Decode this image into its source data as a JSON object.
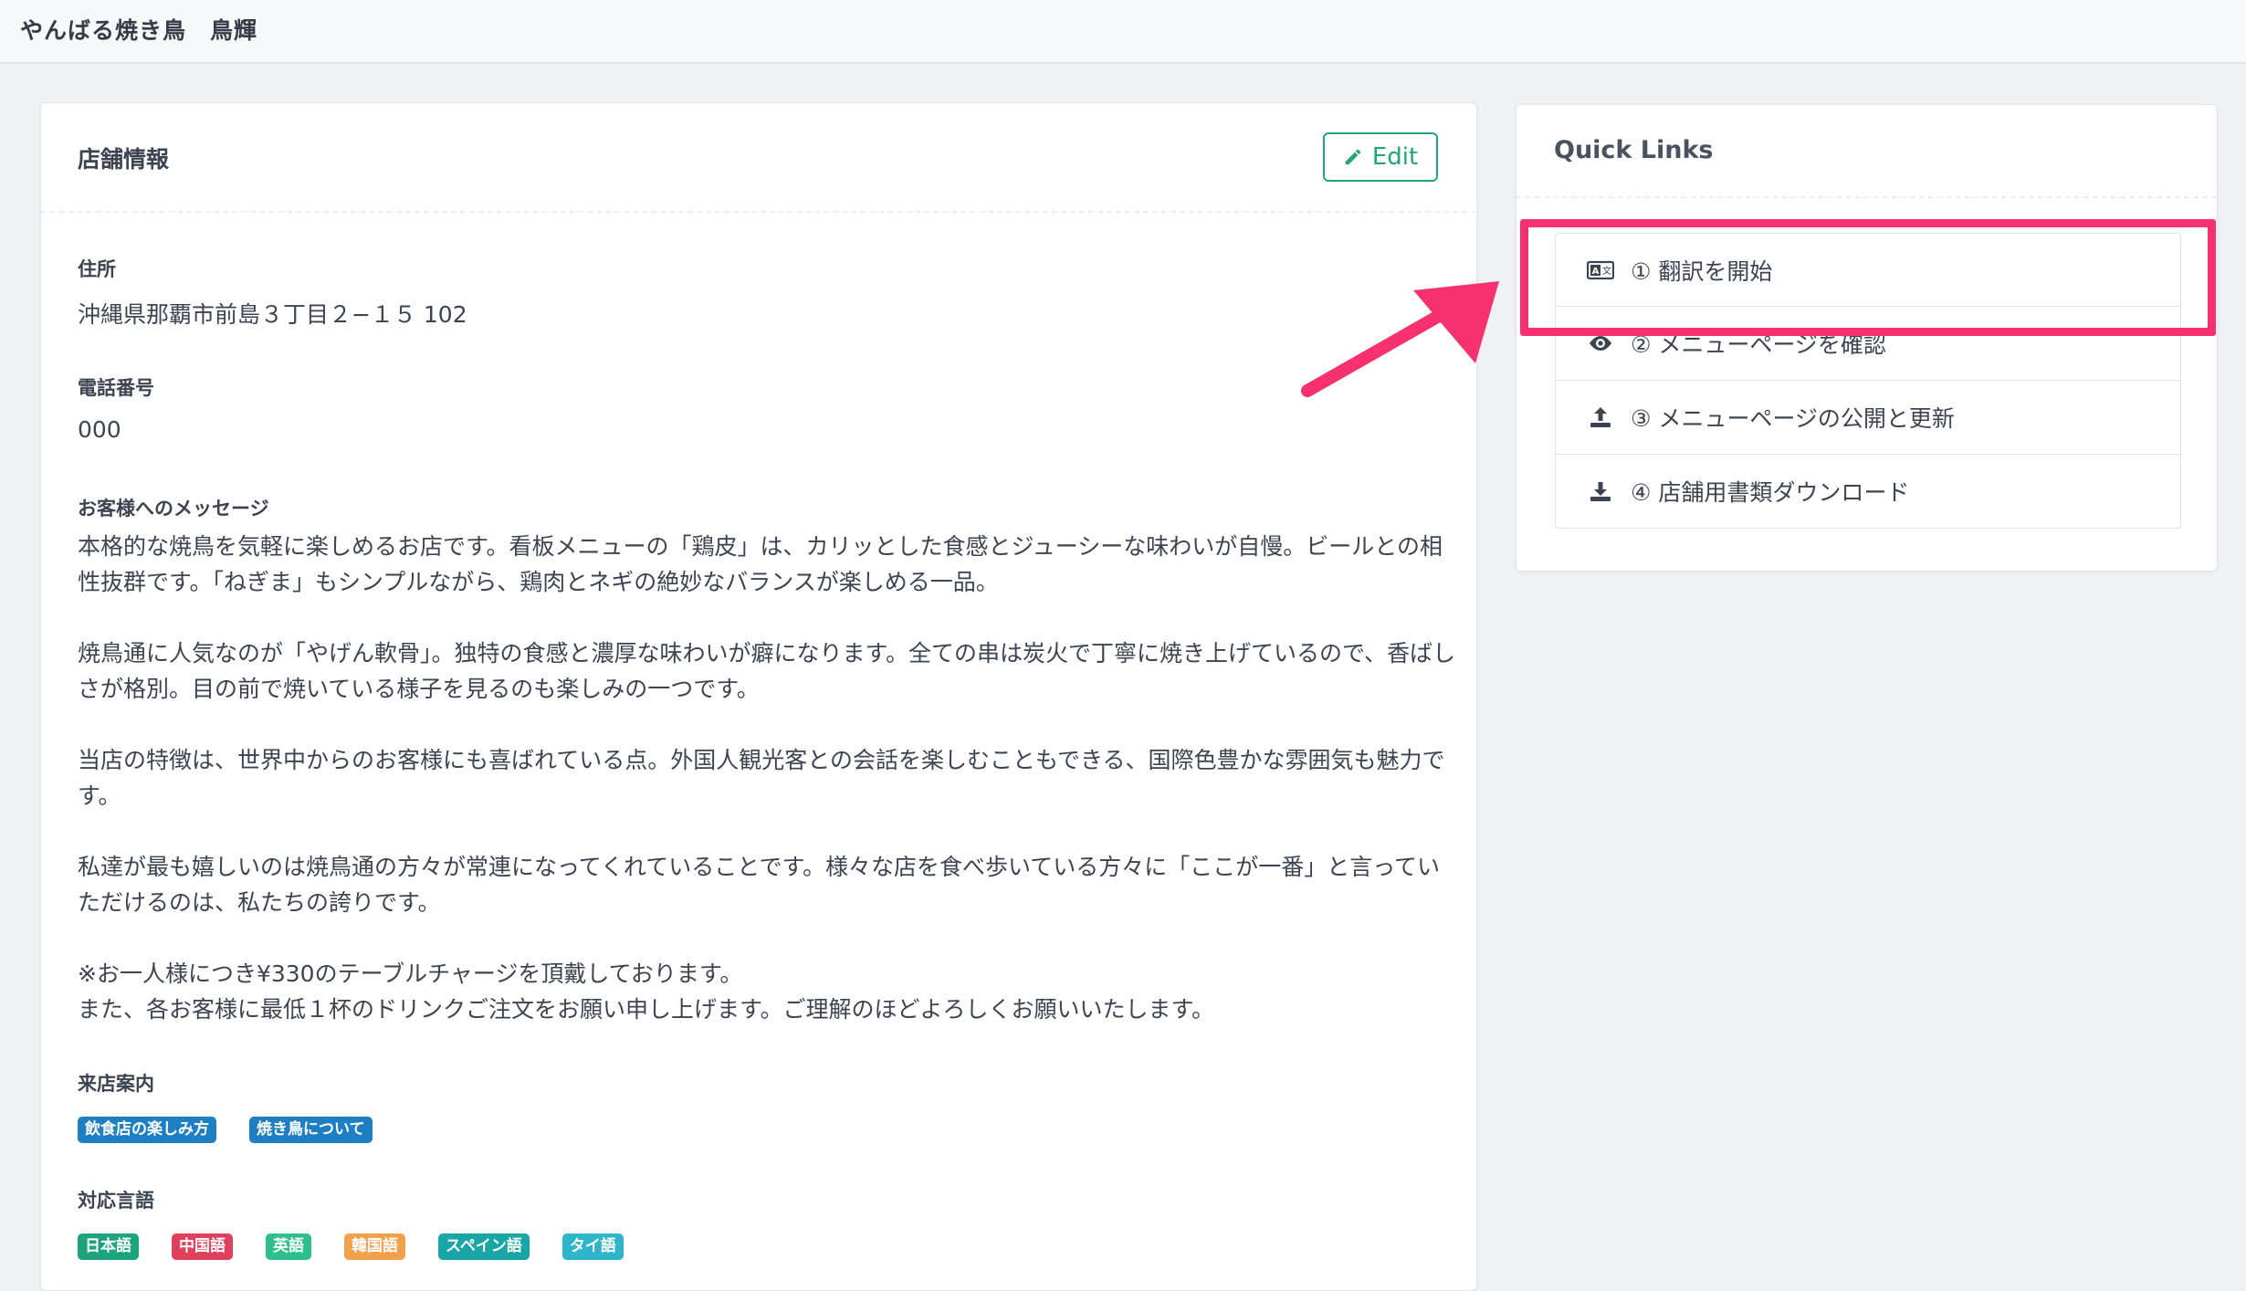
{
  "header": {
    "store_name": "やんばる焼き鳥　鳥輝"
  },
  "store_info": {
    "title": "店舗情報",
    "edit_label": "Edit",
    "address_label": "住所",
    "address": "沖縄県那覇市前島３丁目２−１５ 102",
    "phone_label": "電話番号",
    "phone": "000",
    "message_label": "お客様へのメッセージ",
    "message": "本格的な焼鳥を気軽に楽しめるお店です。看板メニューの「鶏皮」は、カリッとした食感とジューシーな味わいが自慢。ビールとの相性抜群です。「ねぎま」もシンプルながら、鶏肉とネギの絶妙なバランスが楽しめる一品。\n\n焼鳥通に人気なのが「やげん軟骨」。独特の食感と濃厚な味わいが癖になります。全ての串は炭火で丁寧に焼き上げているので、香ばしさが格別。目の前で焼いている様子を見るのも楽しみの一つです。\n\n当店の特徴は、世界中からのお客様にも喜ばれている点。外国人観光客との会話を楽しむこともできる、国際色豊かな雰囲気も魅力です。\n\n私達が最も嬉しいのは焼鳥通の方々が常連になってくれていることです。様々な店を食べ歩いている方々に「ここが一番」と言っていただけるのは、私たちの誇りです。\n\n※お一人様につき¥330のテーブルチャージを頂戴しております。\nまた、各お客様に最低１杯のドリンクご注文をお願い申し上げます。ご理解のほどよろしくお願いいたします。",
    "guide_label": "来店案内",
    "guide_tags": [
      {
        "text": "飲食店の楽しみ方",
        "color": "#1f7fc4"
      },
      {
        "text": "焼き鳥について",
        "color": "#1f7fc4"
      }
    ],
    "languages_label": "対応言語",
    "languages": [
      {
        "text": "日本語",
        "color": "#1ea37f"
      },
      {
        "text": "中国語",
        "color": "#e0405c"
      },
      {
        "text": "英語",
        "color": "#2fbf8a"
      },
      {
        "text": "韓国語",
        "color": "#f2a04b"
      },
      {
        "text": "スペイン語",
        "color": "#1aa6a6"
      },
      {
        "text": "タイ語",
        "color": "#2fb5c9"
      }
    ]
  },
  "quick_links": {
    "title": "Quick Links",
    "items": [
      {
        "label": "① 翻訳を開始",
        "icon": "translate-icon"
      },
      {
        "label": "② メニューページを確認",
        "icon": "eye-icon"
      },
      {
        "label": "③ メニューページの公開と更新",
        "icon": "upload-icon"
      },
      {
        "label": "④ 店舗用書類ダウンロード",
        "icon": "download-icon"
      }
    ]
  },
  "colors": {
    "accent": "#21a67a",
    "highlight": "#f7316f"
  }
}
